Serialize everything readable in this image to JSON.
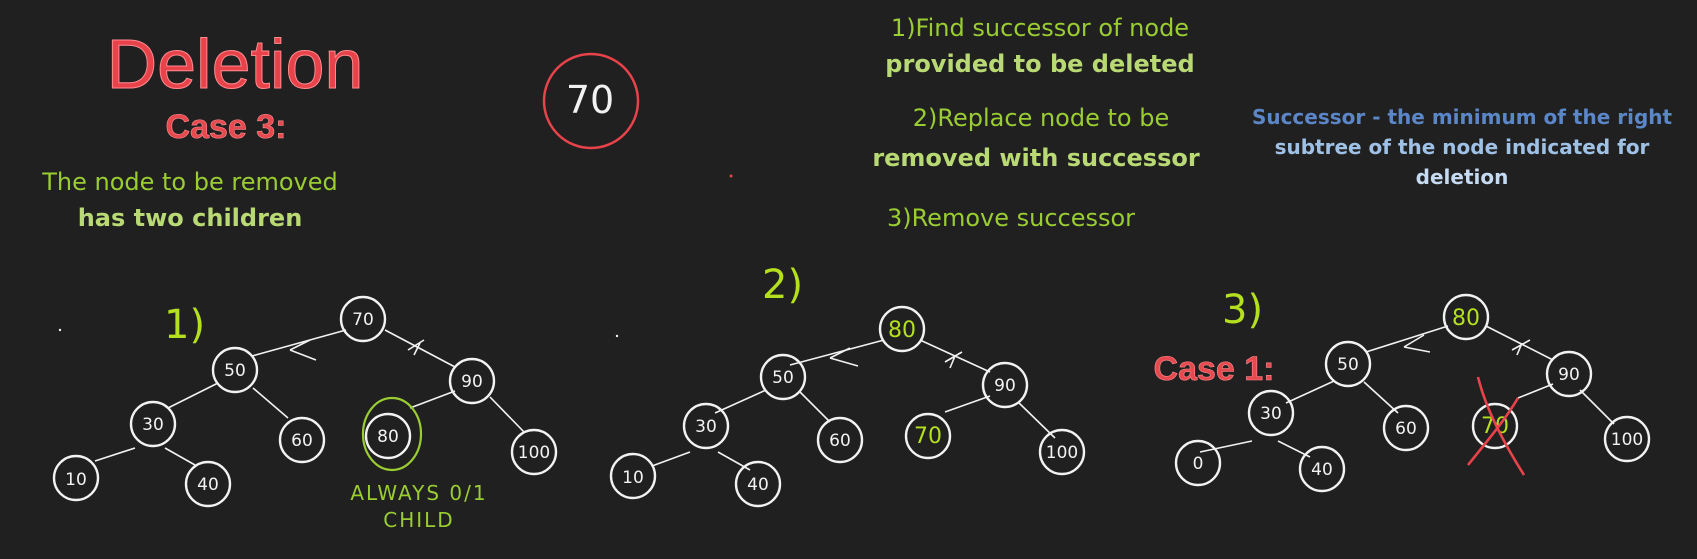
{
  "header": {
    "title": "Deletion",
    "case": "Case 3:",
    "desc_line1": "The node to be removed",
    "desc_line2": "has two children"
  },
  "key_node": "70",
  "steps": {
    "s1_line1": "1)Find successor of node",
    "s1_line2": "provided to be deleted",
    "s2_line1": "2)Replace node to be",
    "s2_line2": "removed with successor",
    "s3": "3)Remove successor"
  },
  "note": {
    "line1": "Successor - the minimum of the right",
    "line2": "subtree of the node indicated for",
    "line3": "deletion"
  },
  "colors": {
    "background": "#202020",
    "red": "#e8434a",
    "green": "#9acd32",
    "lime": "#b5e01f",
    "blue": "#5b86c8",
    "light_blue": "#9fc1e6",
    "white": "#f2f2f2"
  },
  "tree1": {
    "step": "1)",
    "nodes": [
      "70",
      "50",
      "90",
      "30",
      "60",
      "80",
      "100",
      "10",
      "40"
    ],
    "annotation_line1": "ALWAYS 0/1",
    "annotation_line2": "CHILD"
  },
  "tree2": {
    "step": "2)",
    "nodes": [
      "80",
      "50",
      "90",
      "30",
      "60",
      "70",
      "100",
      "10",
      "40"
    ]
  },
  "tree3": {
    "step": "3)",
    "case": "Case 1:",
    "nodes": [
      "80",
      "50",
      "90",
      "30",
      "60",
      "70",
      "100",
      "0",
      "40"
    ]
  }
}
